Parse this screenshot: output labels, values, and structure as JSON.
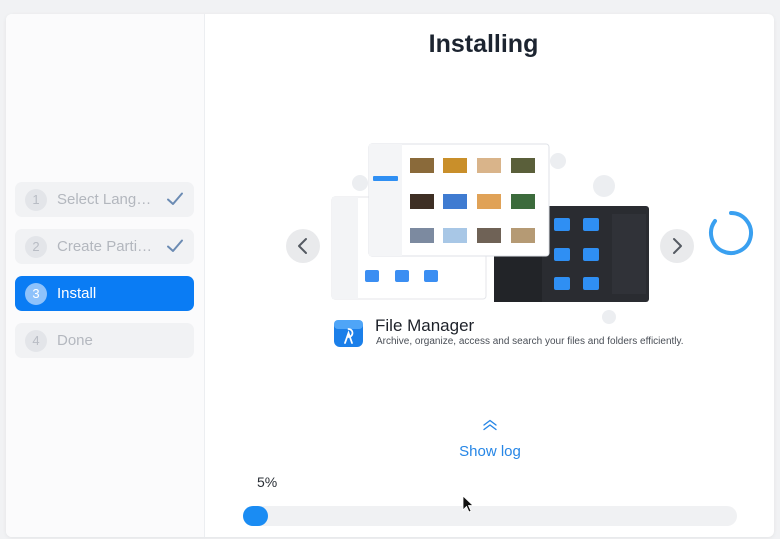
{
  "title": "Installing",
  "steps": [
    {
      "num": "1",
      "label": "Select Langu...",
      "state": "done"
    },
    {
      "num": "2",
      "label": "Create Partiti...",
      "state": "done"
    },
    {
      "num": "3",
      "label": "Install",
      "state": "active"
    },
    {
      "num": "4",
      "label": "Done",
      "state": "pending"
    }
  ],
  "slide": {
    "app_name": "File Manager",
    "app_desc": "Archive, organize, access and search your files and folders efficiently."
  },
  "show_log_label": "Show log",
  "progress": {
    "percent_label": "5%",
    "value": 0.05
  },
  "colors": {
    "accent": "#0a7cf4",
    "link": "#2686e6",
    "spinner": "#3aa0f0",
    "check": "#6b8bb3"
  },
  "icons": {
    "check": "check-icon",
    "prev": "chevron-left-icon",
    "next": "chevron-right-icon",
    "spinner": "loading-spinner-icon",
    "app": "file-manager-icon",
    "show_log": "chevron-up-double-icon",
    "cursor": "mouse-cursor-icon"
  }
}
